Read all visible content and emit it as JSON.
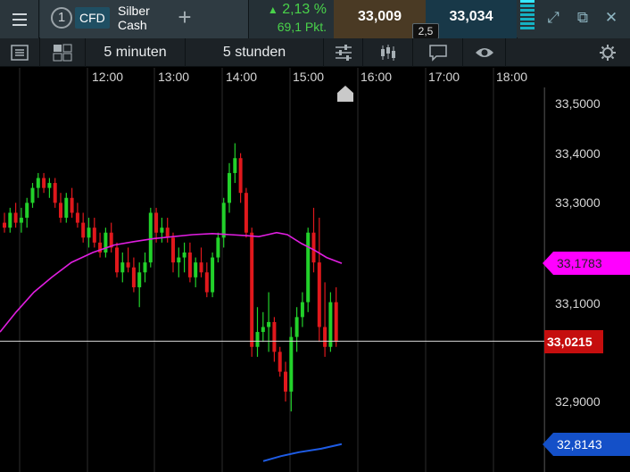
{
  "topbar": {
    "instrument_number": "1",
    "instrument_type": "CFD",
    "instrument_name_line1": "Silber",
    "instrument_name_line2": "Cash",
    "add_label": "+",
    "change_percent": "2,13 %",
    "change_points": "69,1 Pkt.",
    "bid": "33,009",
    "ask": "33,034",
    "spread": "2,5",
    "colors": {
      "up": "#49d24a",
      "bid_bg": "#4a3a24",
      "ask_bg": "#183848"
    }
  },
  "toolbar": {
    "period_label": "5 minuten",
    "range_label": "5 stunden",
    "icons": [
      "list-icon",
      "layout-icon",
      "sliders-icon",
      "candlestick-icon",
      "comment-icon",
      "eye-icon",
      "settings-icon"
    ]
  },
  "time_axis": [
    "12:00",
    "13:00",
    "14:00",
    "15:00",
    "16:00",
    "17:00",
    "18:00"
  ],
  "price_axis": [
    "33,5000",
    "33,4000",
    "33,3000",
    "33,1000",
    "32,9000"
  ],
  "tags": {
    "moving_average": "33,1783",
    "current_price": "33,0215",
    "lower_band": "32,8143",
    "colors": {
      "moving_average": "#ff00ff",
      "current_price": "#c50e0e",
      "lower_band": "#1450c8"
    }
  },
  "chart_data": {
    "type": "candlestick",
    "x_labels": [
      "12:00",
      "13:00",
      "14:00",
      "15:00",
      "16:00",
      "17:00",
      "18:00"
    ],
    "ylim": [
      32.82,
      33.55
    ],
    "current_price": 33.0215,
    "moving_average_last": 33.1783,
    "lower_line_last": 32.8143,
    "candles": [
      [
        33.26,
        33.28,
        33.24,
        33.25
      ],
      [
        33.25,
        33.29,
        33.24,
        33.28
      ],
      [
        33.28,
        33.3,
        33.25,
        33.26
      ],
      [
        33.26,
        33.29,
        33.24,
        33.27
      ],
      [
        33.27,
        33.31,
        33.25,
        33.3
      ],
      [
        33.3,
        33.34,
        33.29,
        33.33
      ],
      [
        33.33,
        33.36,
        33.31,
        33.35
      ],
      [
        33.35,
        33.36,
        33.32,
        33.33
      ],
      [
        33.33,
        33.35,
        33.31,
        33.34
      ],
      [
        33.34,
        33.35,
        33.29,
        33.3
      ],
      [
        33.3,
        33.32,
        33.26,
        33.27
      ],
      [
        33.27,
        33.32,
        33.26,
        33.31
      ],
      [
        33.31,
        33.33,
        33.27,
        33.28
      ],
      [
        33.28,
        33.3,
        33.25,
        33.26
      ],
      [
        33.26,
        33.28,
        33.22,
        33.23
      ],
      [
        33.23,
        33.27,
        33.21,
        33.25
      ],
      [
        33.25,
        33.27,
        33.21,
        33.22
      ],
      [
        33.22,
        33.24,
        33.19,
        33.2
      ],
      [
        33.2,
        33.25,
        33.19,
        33.24
      ],
      [
        33.24,
        33.26,
        33.2,
        33.21
      ],
      [
        33.21,
        33.22,
        33.15,
        33.16
      ],
      [
        33.16,
        33.2,
        33.14,
        33.18
      ],
      [
        33.18,
        33.21,
        33.16,
        33.17
      ],
      [
        33.17,
        33.19,
        33.12,
        33.13
      ],
      [
        33.13,
        33.18,
        33.09,
        33.16
      ],
      [
        33.16,
        33.2,
        33.14,
        33.18
      ],
      [
        33.18,
        33.29,
        33.17,
        33.28
      ],
      [
        33.28,
        33.29,
        33.22,
        33.24
      ],
      [
        33.24,
        33.27,
        33.22,
        33.25
      ],
      [
        33.25,
        33.27,
        33.22,
        33.23
      ],
      [
        33.23,
        33.24,
        33.16,
        33.18
      ],
      [
        33.18,
        33.21,
        33.15,
        33.19
      ],
      [
        33.19,
        33.22,
        33.16,
        33.2
      ],
      [
        33.2,
        33.22,
        33.14,
        33.15
      ],
      [
        33.15,
        33.19,
        33.13,
        33.18
      ],
      [
        33.18,
        33.21,
        33.15,
        33.16
      ],
      [
        33.16,
        33.18,
        33.11,
        33.12
      ],
      [
        33.12,
        33.2,
        33.11,
        33.19
      ],
      [
        33.19,
        33.24,
        33.18,
        33.23
      ],
      [
        33.23,
        33.31,
        33.21,
        33.3
      ],
      [
        33.3,
        33.38,
        33.28,
        33.36
      ],
      [
        33.36,
        33.42,
        33.34,
        33.39
      ],
      [
        33.39,
        33.4,
        33.3,
        33.32
      ],
      [
        33.32,
        33.33,
        33.23,
        33.24
      ],
      [
        33.24,
        33.25,
        32.99,
        33.01
      ],
      [
        33.01,
        33.09,
        32.99,
        33.04
      ],
      [
        33.04,
        33.08,
        33.02,
        33.05
      ],
      [
        33.05,
        33.12,
        33.0,
        33.06
      ],
      [
        33.06,
        33.07,
        32.98,
        33.0
      ],
      [
        33.0,
        33.01,
        32.95,
        32.96
      ],
      [
        32.96,
        32.98,
        32.9,
        32.92
      ],
      [
        32.92,
        33.05,
        32.88,
        33.03
      ],
      [
        33.03,
        33.09,
        33.0,
        33.07
      ],
      [
        33.07,
        33.12,
        33.05,
        33.1
      ],
      [
        33.1,
        33.25,
        33.08,
        33.24
      ],
      [
        33.24,
        33.29,
        33.16,
        33.18
      ],
      [
        33.18,
        33.27,
        33.02,
        33.05
      ],
      [
        33.05,
        33.14,
        32.99,
        33.01
      ],
      [
        33.01,
        33.12,
        33.0,
        33.1
      ],
      [
        33.1,
        33.13,
        33.01,
        33.02
      ]
    ]
  }
}
